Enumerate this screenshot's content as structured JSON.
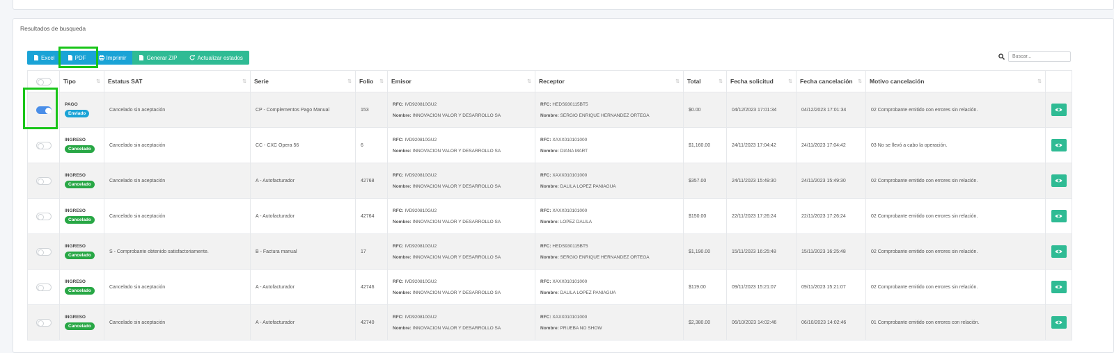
{
  "card_title": "Resultados de busqueda",
  "toolbar": {
    "excel": "Excel",
    "pdf": "PDF",
    "print": "Imprimir",
    "zip": "Generar ZIP",
    "update": "Actualizar estados"
  },
  "search": {
    "placeholder": "Buscar..."
  },
  "columns": [
    "Tipo",
    "Estatus SAT",
    "Serie",
    "Folio",
    "Emisor",
    "Receptor",
    "Total",
    "Fecha solicitud",
    "Fecha cancelación",
    "Motivo cancelación"
  ],
  "labels": {
    "rfc": "RFC:",
    "nombre": "Nombre:"
  },
  "rows": [
    {
      "selected": true,
      "tipo": "PAGO",
      "badge": "Enviado",
      "badge_color": "#1aa3d6",
      "estatus": "Cancelado sin aceptación",
      "serie": "CP - Complementos Pago Manual",
      "folio": "153",
      "emisor_rfc": "IVD920810GU2",
      "emisor_nombre": "INNOVACION VALOR Y DESARROLLO SA",
      "receptor_rfc": "HEDS930115BT5",
      "receptor_nombre": "SERGIO ENRIQUE HERNANDEZ ORTEGA",
      "total": "$0.00",
      "fecha_solicitud": "04/12/2023 17:01:34",
      "fecha_cancelacion": "04/12/2023 17:01:34",
      "motivo": "02 Comprobante emitido con errores sin relación."
    },
    {
      "selected": false,
      "tipo": "INGRESO",
      "badge": "Cancelado",
      "badge_color": "#28a745",
      "estatus": "Cancelado sin aceptación",
      "serie": "CC - CXC Opera 56",
      "folio": "6",
      "emisor_rfc": "IVD920810GU2",
      "emisor_nombre": "INNOVACION VALOR Y DESARROLLO SA",
      "receptor_rfc": "XAXX010101000",
      "receptor_nombre": "DIANA MART",
      "total": "$1,160.00",
      "fecha_solicitud": "24/11/2023 17:04:42",
      "fecha_cancelacion": "24/11/2023 17:04:42",
      "motivo": "03 No se llevó a cabo la operación."
    },
    {
      "selected": false,
      "tipo": "INGRESO",
      "badge": "Cancelado",
      "badge_color": "#28a745",
      "estatus": "Cancelado sin aceptación",
      "serie": "A - Autofacturador",
      "folio": "42768",
      "emisor_rfc": "IVD920810GU2",
      "emisor_nombre": "INNOVACION VALOR Y DESARROLLO SA",
      "receptor_rfc": "XAXX010101000",
      "receptor_nombre": "DALILA LOPEZ PANIAGUA",
      "total": "$357.00",
      "fecha_solicitud": "24/11/2023 15:49:30",
      "fecha_cancelacion": "24/11/2023 15:49:30",
      "motivo": "02 Comprobante emitido con errores sin relación."
    },
    {
      "selected": false,
      "tipo": "INGRESO",
      "badge": "Cancelado",
      "badge_color": "#28a745",
      "estatus": "Cancelado sin aceptación",
      "serie": "A - Autofacturador",
      "folio": "42764",
      "emisor_rfc": "IVD920810GU2",
      "emisor_nombre": "INNOVACION VALOR Y DESARROLLO SA",
      "receptor_rfc": "XAXX010101000",
      "receptor_nombre": "LOPEZ DALILA",
      "total": "$150.00",
      "fecha_solicitud": "22/11/2023 17:26:24",
      "fecha_cancelacion": "22/11/2023 17:26:24",
      "motivo": "02 Comprobante emitido con errores sin relación."
    },
    {
      "selected": false,
      "tipo": "INGRESO",
      "badge": "Cancelado",
      "badge_color": "#28a745",
      "estatus": "S - Comprobante obtenido satisfactoriamente.",
      "serie": "B - Factura manual",
      "folio": "17",
      "emisor_rfc": "IVD920810GU2",
      "emisor_nombre": "INNOVACION VALOR Y DESARROLLO SA",
      "receptor_rfc": "HEDS930115BT5",
      "receptor_nombre": "SERGIO ENRIQUE HERNANDEZ ORTEGA",
      "total": "$1,190.00",
      "fecha_solicitud": "15/11/2023 16:25:48",
      "fecha_cancelacion": "15/11/2023 16:25:48",
      "motivo": "02 Comprobante emitido con errores sin relación."
    },
    {
      "selected": false,
      "tipo": "INGRESO",
      "badge": "Cancelado",
      "badge_color": "#28a745",
      "estatus": "Cancelado sin aceptación",
      "serie": "A - Autofacturador",
      "folio": "42746",
      "emisor_rfc": "IVD920810GU2",
      "emisor_nombre": "INNOVACION VALOR Y DESARROLLO SA",
      "receptor_rfc": "XAXX010101000",
      "receptor_nombre": "DALILA LOPEZ PANIAGUA",
      "total": "$119.00",
      "fecha_solicitud": "09/11/2023 15:21:07",
      "fecha_cancelacion": "09/11/2023 15:21:07",
      "motivo": "02 Comprobante emitido con errores sin relación."
    },
    {
      "selected": false,
      "tipo": "INGRESO",
      "badge": "Cancelado",
      "badge_color": "#28a745",
      "estatus": "Cancelado sin aceptación",
      "serie": "A - Autofacturador",
      "folio": "42740",
      "emisor_rfc": "IVD920810GU2",
      "emisor_nombre": "INNOVACION VALOR Y DESARROLLO SA",
      "receptor_rfc": "XAXX010101000",
      "receptor_nombre": "PRUEBA NO SHOW",
      "total": "$2,380.00",
      "fecha_solicitud": "06/10/2023 14:02:46",
      "fecha_cancelacion": "06/10/2023 14:02:46",
      "motivo": "01 Comprobante emitido con errores con relación."
    }
  ]
}
